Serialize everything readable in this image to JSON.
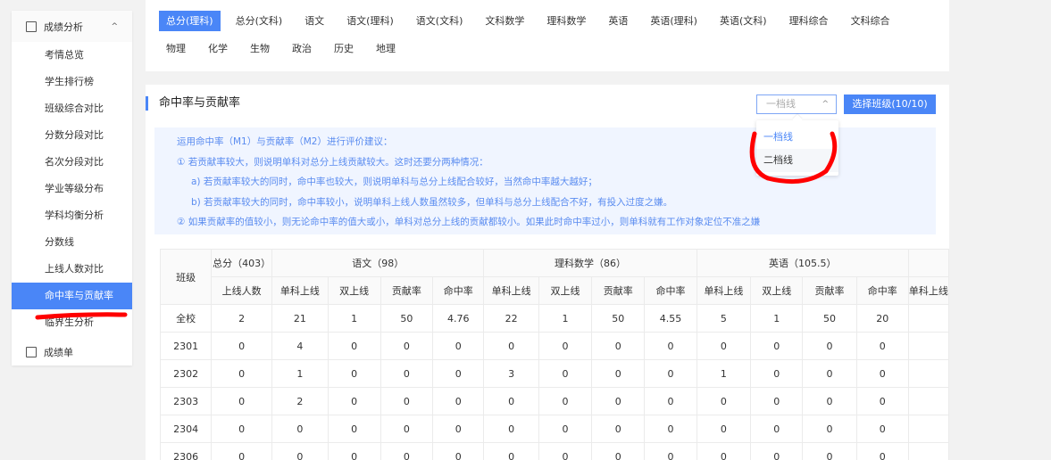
{
  "sidebar": {
    "group": "成绩分析",
    "items": [
      "考情总览",
      "学生排行榜",
      "班级综合对比",
      "分数分段对比",
      "名次分段对比",
      "学业等级分布",
      "学科均衡分析",
      "分数线",
      "上线人数对比",
      "命中率与贡献率",
      "临界生分析"
    ],
    "active_index": 9,
    "bottom": "成绩单"
  },
  "subject_tabs": [
    "总分(理科)",
    "总分(文科)",
    "语文",
    "语文(理科)",
    "语文(文科)",
    "文科数学",
    "理科数学",
    "英语",
    "英语(理科)",
    "英语(文科)",
    "理科综合",
    "文科综合",
    "物理",
    "化学",
    "生物",
    "政治",
    "历史",
    "地理"
  ],
  "section": {
    "title": "命中率与贡献率",
    "select_value": "一档线",
    "select_options": [
      "一档线",
      "二档线"
    ],
    "class_button": "选择班级(10/10)"
  },
  "tips": [
    "运用命中率（M1）与贡献率（M2）进行评价建议：",
    "① 若贡献率较大，则说明单科对总分上线贡献较大。这时还要分两种情况：",
    "a) 若贡献率较大的同时，命中率也较大，则说明单科与总分上线配合较好，当然命中率越大越好；",
    "b) 若贡献率较大的同时，命中率较小，说明单科上线人数虽然较多，但单科与总分上线配合不好，有投入过度之嫌。",
    "② 如果贡献率的值较小，则无论命中率的值大或小，单科对总分上线的贡献都较小。如果此时命中率过小，则单科就有工作对象定位不准之嫌"
  ],
  "table": {
    "class_header": "班级",
    "groups": [
      {
        "name": "总分（403）",
        "cols": [
          "上线人数"
        ]
      },
      {
        "name": "语文（98）",
        "cols": [
          "单科上线",
          "双上线",
          "贡献率",
          "命中率"
        ]
      },
      {
        "name": "理科数学（86）",
        "cols": [
          "单科上线",
          "双上线",
          "贡献率",
          "命中率"
        ]
      },
      {
        "name": "英语（105.5）",
        "cols": [
          "单科上线",
          "双上线",
          "贡献率",
          "命中率"
        ]
      },
      {
        "name": "",
        "cols": [
          "单科上线"
        ]
      }
    ],
    "rows": [
      [
        "全校",
        "2",
        "21",
        "1",
        "50",
        "4.76",
        "22",
        "1",
        "50",
        "4.55",
        "5",
        "1",
        "50",
        "20",
        ""
      ],
      [
        "2301",
        "0",
        "4",
        "0",
        "0",
        "0",
        "0",
        "0",
        "0",
        "0",
        "0",
        "0",
        "0",
        "0",
        ""
      ],
      [
        "2302",
        "0",
        "1",
        "0",
        "0",
        "0",
        "3",
        "0",
        "0",
        "0",
        "1",
        "0",
        "0",
        "0",
        ""
      ],
      [
        "2303",
        "0",
        "2",
        "0",
        "0",
        "0",
        "0",
        "0",
        "0",
        "0",
        "0",
        "0",
        "0",
        "0",
        ""
      ],
      [
        "2304",
        "0",
        "0",
        "0",
        "0",
        "0",
        "0",
        "0",
        "0",
        "0",
        "0",
        "0",
        "0",
        "0",
        ""
      ],
      [
        "2306",
        "0",
        "0",
        "0",
        "0",
        "0",
        "0",
        "0",
        "0",
        "0",
        "0",
        "0",
        "0",
        "0",
        ""
      ]
    ]
  },
  "colors": {
    "accent": "#4a86f7",
    "annotation": "#ff0000"
  }
}
